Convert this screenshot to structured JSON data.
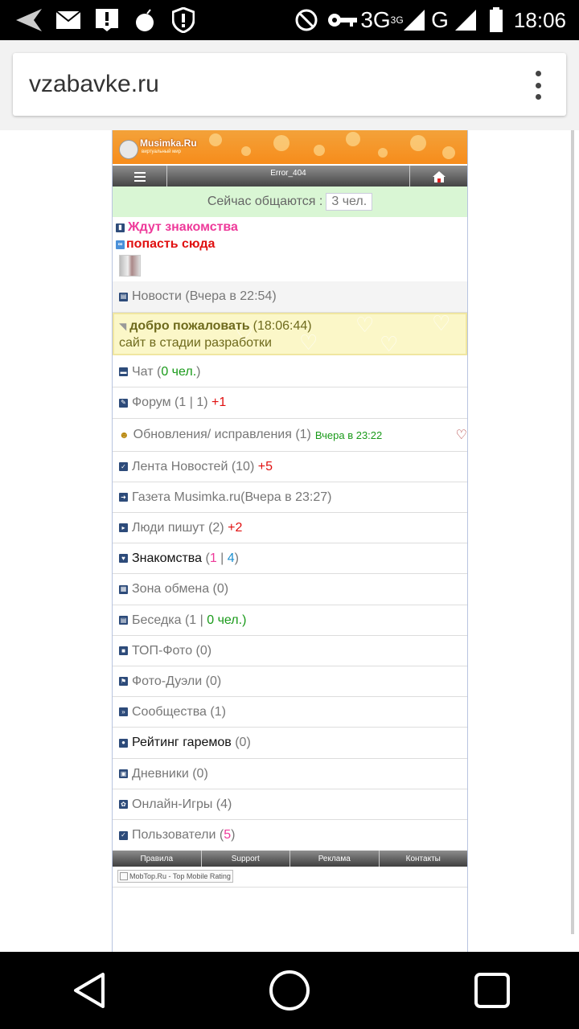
{
  "status_bar": {
    "time": "18:06",
    "network": "3G",
    "network_sup": "3G",
    "network2": "G",
    "icons": [
      "signal-arrow-icon",
      "mail-icon",
      "alert-icon",
      "bomb-icon",
      "shield-alert-icon",
      "do-not-disturb-icon",
      "key-icon",
      "signal-icon",
      "battery-icon"
    ]
  },
  "browser": {
    "url": "vzabavke.ru",
    "menu_icon": "more-vert-icon"
  },
  "site": {
    "logo_text": "Musimka.Ru",
    "logo_sub": "виртуальный мир",
    "nav": {
      "menu_icon": "hamburger-icon",
      "user": "Error_404",
      "home_icon": "home-icon"
    },
    "online": {
      "label": "Сейчас общаются :",
      "count": "3 чел."
    },
    "featured": {
      "title": "Ждут знакомства",
      "link": "попасть сюда"
    },
    "news_header": "Новости (Вчера в 22:54)",
    "news": {
      "title": "добро пожаловать",
      "time": "(18:06:44)",
      "text": "сайт в стадии разработки"
    },
    "menu": {
      "chat": {
        "label": "Чат (",
        "count": "0 чел.",
        "close": ")"
      },
      "forum": {
        "label": "Форум (1 | 1)",
        "extra": "+1"
      },
      "updates": {
        "label": "Обновления/ исправления (1)",
        "time": "Вчера в 23:22"
      },
      "feed": {
        "label": "Лента Новостей (10)",
        "extra": "+5"
      },
      "gazeta": {
        "label": "Газета Musimka.ru(Вчера в 23:27)"
      },
      "people": {
        "label": "Люди пишут (2)",
        "extra": "+2"
      },
      "dating": {
        "label": "Знакомства",
        "open": " (",
        "a": "1",
        "sep": " | ",
        "b": "4",
        "close": ")"
      },
      "exchange": {
        "label": "Зона обмена (0)"
      },
      "besedka": {
        "label": "Беседка (1 | ",
        "count": "0 чел.",
        "close": ")"
      },
      "top_photo": {
        "label": "ТОП-Фото (0)"
      },
      "photo_duels": {
        "label": "Фото-Дуэли (0)"
      },
      "communities": {
        "label": "Сообщества (1)"
      },
      "harems": {
        "label": "Рейтинг гаремов",
        "count": " (0)"
      },
      "diaries": {
        "label": "Дневники (0)"
      },
      "games": {
        "label": "Онлайн-Игры (4)"
      },
      "users": {
        "label": "Пользователи (",
        "count": "5",
        "close": ")"
      }
    },
    "footer": [
      "Правила",
      "Support",
      "Реклама",
      "Контакты"
    ],
    "mobtop": "MobTop.Ru - Top Mobile Rating"
  },
  "system_nav": {
    "back_icon": "back-triangle-icon",
    "home_icon": "home-circle-icon",
    "recents_icon": "recents-square-icon"
  }
}
